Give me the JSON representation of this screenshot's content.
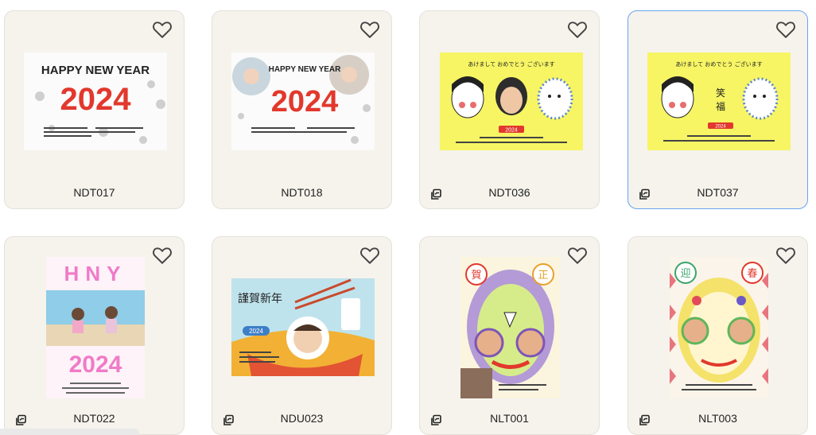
{
  "cards": [
    {
      "code": "NDT017",
      "thumb_text": "HAPPY NEW YEAR",
      "thumb_year": "2024",
      "multi": false,
      "selected": false
    },
    {
      "code": "NDT018",
      "thumb_text": "HAPPY NEW YEAR",
      "thumb_year": "2024",
      "multi": false,
      "selected": false
    },
    {
      "code": "NDT036",
      "thumb_text": "あけまして おめでとう ございます",
      "thumb_year": "2024",
      "multi": true,
      "selected": false
    },
    {
      "code": "NDT037",
      "thumb_text": "あけまして おめでとう ございます",
      "thumb_year": "2024",
      "multi": true,
      "selected": true
    },
    {
      "code": "NDT022",
      "thumb_text": "HNY",
      "thumb_year": "2024",
      "multi": true,
      "selected": false
    },
    {
      "code": "NDU023",
      "thumb_text": "謹賀新年",
      "thumb_year": "2024",
      "multi": true,
      "selected": false
    },
    {
      "code": "NLT001",
      "thumb_text": "賀正",
      "thumb_year": "",
      "multi": true,
      "selected": false
    },
    {
      "code": "NLT003",
      "thumb_text": "迎春",
      "thumb_year": "",
      "multi": true,
      "selected": false
    }
  ],
  "icons": {
    "favorite": "heart-outline-icon",
    "multi": "layers-icon"
  },
  "colors": {
    "card_bg": "#f5f3ec",
    "selected_border": "#6aa4f0",
    "accent_red": "#e2382d",
    "accent_yellow": "#f7f564"
  }
}
